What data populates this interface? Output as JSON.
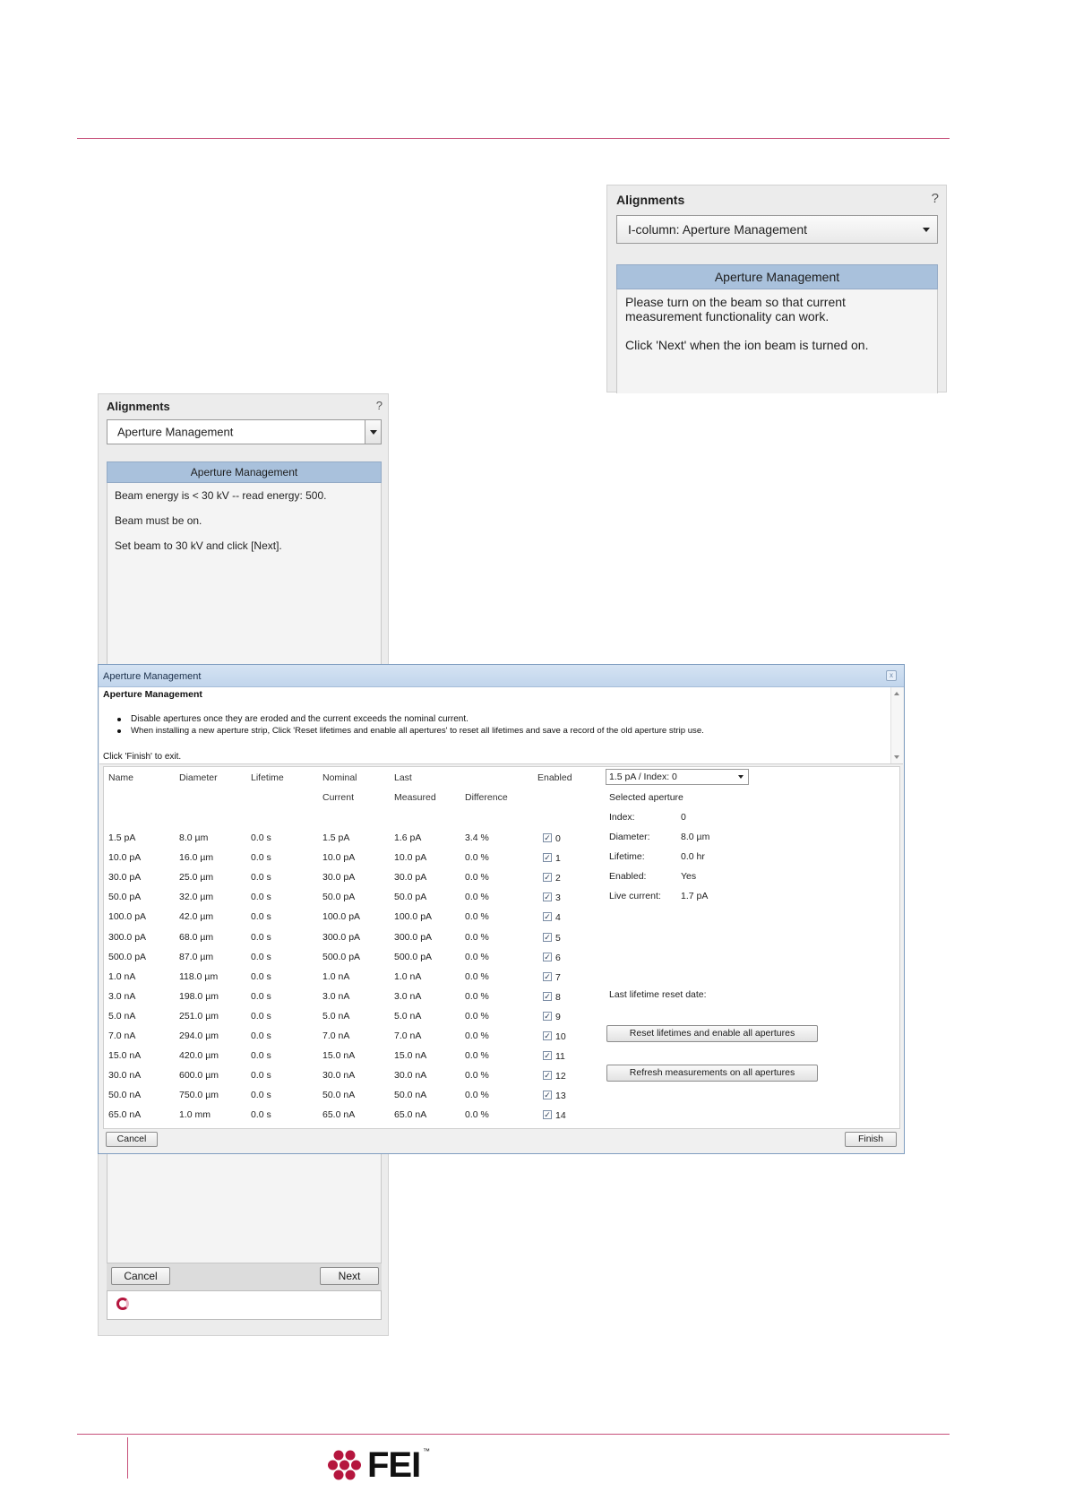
{
  "panel_right": {
    "title": "Alignments",
    "help": "?",
    "dropdown_value": "I-column: Aperture Management",
    "section_header": "Aperture Management",
    "message_line1": "Please turn on the beam so that current",
    "message_line2": "measurement functionality can work.",
    "message_line3": "Click 'Next' when the ion beam is turned on."
  },
  "panel_left": {
    "title": "Alignments",
    "help": "?",
    "dropdown_value": "Aperture Management",
    "section_header": "Aperture Management",
    "message_line1": "Beam energy is < 30 kV -- read energy: 500.",
    "message_line2": "Beam must be on.",
    "message_line3": "Set beam to 30 kV and click [Next].",
    "cancel_label": "Cancel",
    "next_label": "Next"
  },
  "dialog": {
    "title": "Aperture Management",
    "info_heading": "Aperture Management",
    "bullet1": "Disable apertures once they are eroded and the current exceeds the nominal current.",
    "bullet2": "When installing a new aperture strip, Click 'Reset lifetimes and enable all apertures' to reset all lifetimes and save a record of the old aperture strip use.",
    "exit_note": "Click 'Finish' to exit.",
    "headers": {
      "name": "Name",
      "diameter": "Diameter",
      "lifetime": "Lifetime",
      "nominal1": "Nominal",
      "nominal2": "Current",
      "last1": "Last",
      "last2": "Measured",
      "difference": "Difference",
      "enabled": "Enabled"
    },
    "rows": [
      {
        "name": "1.5 pA",
        "diameter": "8.0 µm",
        "lifetime": "0.0 s",
        "nominal": "1.5 pA",
        "measured": "1.6 pA",
        "difference": "3.4 %",
        "index": "0"
      },
      {
        "name": "10.0 pA",
        "diameter": "16.0 µm",
        "lifetime": "0.0 s",
        "nominal": "10.0 pA",
        "measured": "10.0 pA",
        "difference": "0.0 %",
        "index": "1"
      },
      {
        "name": "30.0 pA",
        "diameter": "25.0 µm",
        "lifetime": "0.0 s",
        "nominal": "30.0 pA",
        "measured": "30.0 pA",
        "difference": "0.0 %",
        "index": "2"
      },
      {
        "name": "50.0 pA",
        "diameter": "32.0 µm",
        "lifetime": "0.0 s",
        "nominal": "50.0 pA",
        "measured": "50.0 pA",
        "difference": "0.0 %",
        "index": "3"
      },
      {
        "name": "100.0 pA",
        "diameter": "42.0 µm",
        "lifetime": "0.0 s",
        "nominal": "100.0 pA",
        "measured": "100.0 pA",
        "difference": "0.0 %",
        "index": "4"
      },
      {
        "name": "300.0 pA",
        "diameter": "68.0 µm",
        "lifetime": "0.0 s",
        "nominal": "300.0 pA",
        "measured": "300.0 pA",
        "difference": "0.0 %",
        "index": "5"
      },
      {
        "name": "500.0 pA",
        "diameter": "87.0 µm",
        "lifetime": "0.0 s",
        "nominal": "500.0 pA",
        "measured": "500.0 pA",
        "difference": "0.0 %",
        "index": "6"
      },
      {
        "name": "1.0 nA",
        "diameter": "118.0 µm",
        "lifetime": "0.0 s",
        "nominal": "1.0 nA",
        "measured": "1.0 nA",
        "difference": "0.0 %",
        "index": "7"
      },
      {
        "name": "3.0 nA",
        "diameter": "198.0 µm",
        "lifetime": "0.0 s",
        "nominal": "3.0 nA",
        "measured": "3.0 nA",
        "difference": "0.0 %",
        "index": "8"
      },
      {
        "name": "5.0 nA",
        "diameter": "251.0 µm",
        "lifetime": "0.0 s",
        "nominal": "5.0 nA",
        "measured": "5.0 nA",
        "difference": "0.0 %",
        "index": "9"
      },
      {
        "name": "7.0 nA",
        "diameter": "294.0 µm",
        "lifetime": "0.0 s",
        "nominal": "7.0 nA",
        "measured": "7.0 nA",
        "difference": "0.0 %",
        "index": "10"
      },
      {
        "name": "15.0 nA",
        "diameter": "420.0 µm",
        "lifetime": "0.0 s",
        "nominal": "15.0 nA",
        "measured": "15.0 nA",
        "difference": "0.0 %",
        "index": "11"
      },
      {
        "name": "30.0 nA",
        "diameter": "600.0 µm",
        "lifetime": "0.0 s",
        "nominal": "30.0 nA",
        "measured": "30.0 nA",
        "difference": "0.0 %",
        "index": "12"
      },
      {
        "name": "50.0 nA",
        "diameter": "750.0 µm",
        "lifetime": "0.0 s",
        "nominal": "50.0 nA",
        "measured": "50.0 nA",
        "difference": "0.0 %",
        "index": "13"
      },
      {
        "name": "65.0 nA",
        "diameter": "1.0 mm",
        "lifetime": "0.0 s",
        "nominal": "65.0 nA",
        "measured": "65.0 nA",
        "difference": "0.0 %",
        "index": "14"
      }
    ],
    "selector_value": "1.5 pA / Index: 0",
    "selected_heading": "Selected aperture",
    "details": {
      "index_label": "Index:",
      "index_value": "0",
      "diameter_label": "Diameter:",
      "diameter_value": "8.0 µm",
      "lifetime_label": "Lifetime:",
      "lifetime_value": "0.0 hr",
      "enabled_label": "Enabled:",
      "enabled_value": "Yes",
      "live_label": "Live current:",
      "live_value": "1.7 pA"
    },
    "reset_date_label": "Last lifetime reset date:",
    "reset_button": "Reset lifetimes and enable all apertures",
    "refresh_button": "Refresh measurements on all apertures",
    "cancel_label": "Cancel",
    "finish_label": "Finish"
  },
  "footer": {
    "logo_text": "FEI",
    "tm": "™"
  },
  "colors": {
    "rule": "#c7507a",
    "section_header": "#a9c1dc",
    "dialog_titlebar": "#c1d5ec",
    "logo": "#b5163e"
  }
}
